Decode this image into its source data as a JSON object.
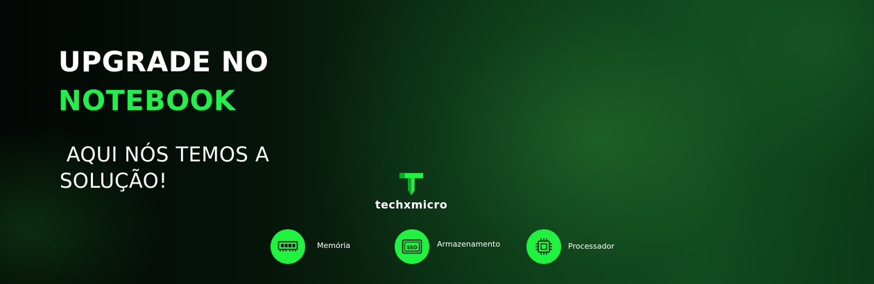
{
  "headline": {
    "line1": "UPGRADE NO",
    "line2": "NOTEBOOK"
  },
  "subheadline": {
    "line1": " AQUI NÓS TEMOS A",
    "line2": "SOLUÇÃO!"
  },
  "logo": {
    "name": "techxmicro",
    "icon": "t-logo-icon"
  },
  "features": [
    {
      "label": "Memória",
      "icon": "memory-icon"
    },
    {
      "label": "Armazenamento",
      "icon": "ssd-icon"
    },
    {
      "label": "Processador",
      "icon": "processor-icon"
    }
  ],
  "colors": {
    "accent": "#22f04a",
    "text": "#ffffff",
    "background_dark": "#030604",
    "background_green": "#0f4a1e"
  }
}
